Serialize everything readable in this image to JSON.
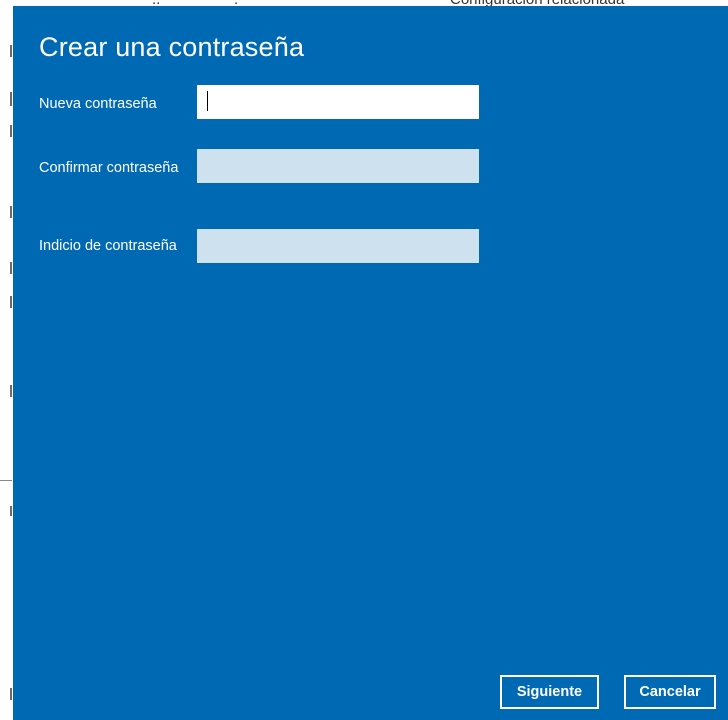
{
  "background": {
    "heading_fragment": "Configuración relacionada"
  },
  "dialog": {
    "title": "Crear una contraseña",
    "fields": [
      {
        "label": "Nueva contraseña",
        "value": "",
        "state": "focused"
      },
      {
        "label": "Confirmar contraseña",
        "value": "",
        "state": "idle"
      },
      {
        "label": "Indicio de contraseña",
        "value": "",
        "state": "idle"
      }
    ],
    "buttons": {
      "next_label": "Siguiente",
      "cancel_label": "Cancelar"
    },
    "colors": {
      "dialog_bg": "#0069b4",
      "input_active_bg": "#ffffff",
      "input_idle_bg": "#cde1ef",
      "text": "#ffffff"
    }
  }
}
